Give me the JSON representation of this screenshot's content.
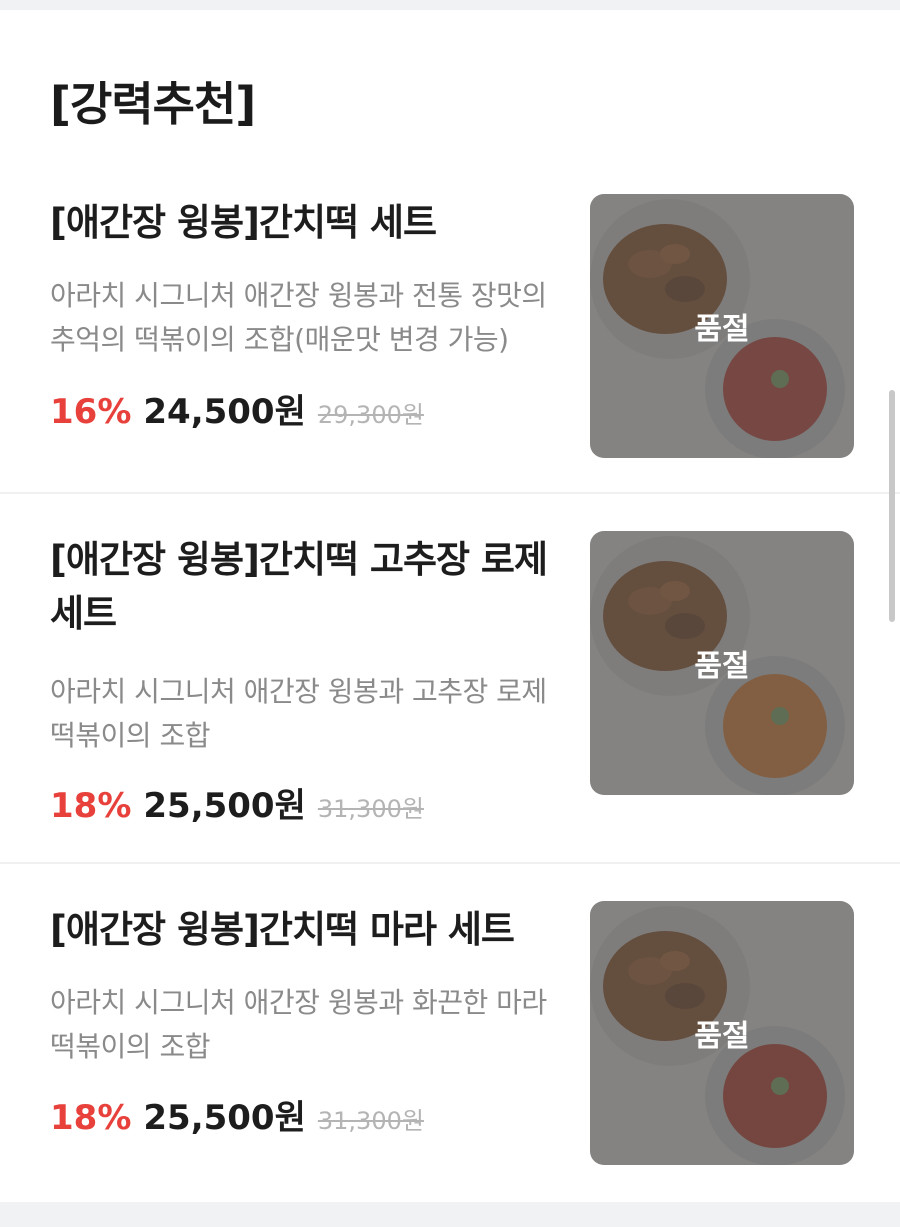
{
  "section": {
    "title": "[강력추천]"
  },
  "items": [
    {
      "name": "[애간장 윙봉]간치떡 세트",
      "description": "아라치 시그니처 애간장 윙봉과 전통 장맛의 추억의 떡볶이의 조합(매운맛 변경 가능)",
      "discount": "16%",
      "price": "24,500원",
      "original_price": "29,300원",
      "badge": "품절",
      "sauce_color": "#c0392b"
    },
    {
      "name": "[애간장 윙봉]간치떡 고추장 로제 세트",
      "description": "아라치 시그니처 애간장 윙봉과 고추장 로제떡볶이의 조합",
      "discount": "18%",
      "price": "25,500원",
      "original_price": "31,300원",
      "badge": "품절",
      "sauce_color": "#e07b2a"
    },
    {
      "name": "[애간장 윙봉]간치떡 마라 세트",
      "description": "아라치 시그니처 애간장 윙봉과 화끈한 마라떡볶이의 조합",
      "discount": "18%",
      "price": "25,500원",
      "original_price": "31,300원",
      "badge": "품절",
      "sauce_color": "#b8321f"
    }
  ],
  "colors": {
    "discount": "#e8403b",
    "text": "#1d1d1d",
    "muted": "#8a8a8a"
  }
}
